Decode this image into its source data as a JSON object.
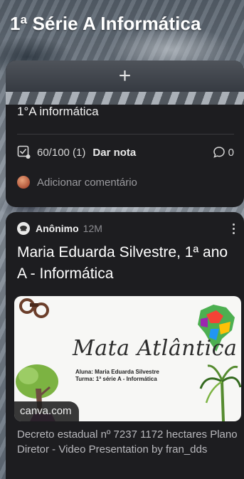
{
  "header": {
    "title": "1ª Série A Informática"
  },
  "assignment_card": {
    "add_icon": "plus-icon",
    "title": "1°A informática",
    "score": "60/100 (1)",
    "grade_label": "Dar nota",
    "comment_count": "0",
    "add_comment_label": "Adicionar comentário"
  },
  "post": {
    "author": "Anônimo",
    "timestamp": "12M",
    "title": "Maria Eduarda Silvestre, 1ª ano A - Informática",
    "preview": {
      "heading": "Mata Atlântica",
      "student_line": "Aluna: Maria Eduarda Silvestre",
      "class_line": "Turma: 1ª série A - Informática",
      "source": "canva.com"
    },
    "description": "Decreto estadual nº 7237 1172 hectares Plano Diretor - Video Presentation by fran_dds"
  },
  "colors": {
    "card_bg": "#1d1d20",
    "text_primary": "#ffffff",
    "text_muted": "#9a9a9e"
  }
}
